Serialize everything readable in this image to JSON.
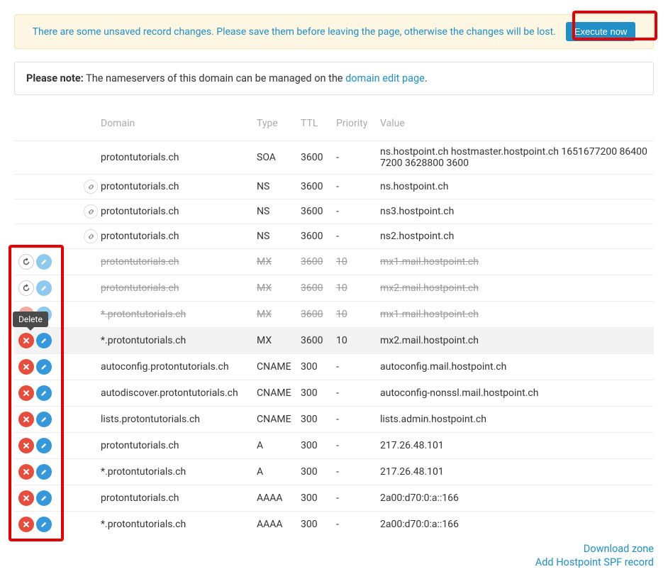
{
  "alert": {
    "message": "There are some unsaved record changes. Please save them before leaving the page, otherwise the changes will be lost.",
    "button": "Execute now"
  },
  "note": {
    "label": "Please note:",
    "text": " The nameservers of this domain can be managed on the ",
    "link": "domain edit page",
    "suffix": "."
  },
  "tooltip": {
    "delete": "Delete"
  },
  "headers": {
    "domain": "Domain",
    "type": "Type",
    "ttl": "TTL",
    "priority": "Priority",
    "value": "Value"
  },
  "rows": [
    {
      "actions": "none",
      "link": false,
      "domain": "protontutorials.ch",
      "type": "SOA",
      "ttl": "3600",
      "priority": "-",
      "value": "ns.hostpoint.ch hostmaster.hostpoint.ch 1651677200 86400 7200 3628800 3600",
      "struck": false,
      "highlight": false
    },
    {
      "actions": "link",
      "link": true,
      "domain": "protontutorials.ch",
      "type": "NS",
      "ttl": "3600",
      "priority": "-",
      "value": "ns.hostpoint.ch",
      "struck": false,
      "highlight": false
    },
    {
      "actions": "link",
      "link": true,
      "domain": "protontutorials.ch",
      "type": "NS",
      "ttl": "3600",
      "priority": "-",
      "value": "ns3.hostpoint.ch",
      "struck": false,
      "highlight": false
    },
    {
      "actions": "link",
      "link": true,
      "domain": "protontutorials.ch",
      "type": "NS",
      "ttl": "3600",
      "priority": "-",
      "value": "ns2.hostpoint.ch",
      "struck": false,
      "highlight": false
    },
    {
      "actions": "revert",
      "link": false,
      "domain": "protontutorials.ch",
      "type": "MX",
      "ttl": "3600",
      "priority": "10",
      "value": "mx1.mail.hostpoint.ch",
      "struck": true,
      "highlight": false
    },
    {
      "actions": "revert",
      "link": false,
      "domain": "protontutorials.ch",
      "type": "MX",
      "ttl": "3600",
      "priority": "10",
      "value": "mx2.mail.hostpoint.ch",
      "struck": true,
      "highlight": false
    },
    {
      "actions": "lightdel",
      "link": false,
      "domain": "*.protontutorials.ch",
      "type": "MX",
      "ttl": "3600",
      "priority": "10",
      "value": "mx1.mail.hostpoint.ch",
      "struck": true,
      "highlight": false
    },
    {
      "actions": "full",
      "link": false,
      "domain": "*.protontutorials.ch",
      "type": "MX",
      "ttl": "3600",
      "priority": "10",
      "value": "mx2.mail.hostpoint.ch",
      "struck": false,
      "highlight": true
    },
    {
      "actions": "full",
      "link": false,
      "domain": "autoconfig.protontutorials.ch",
      "type": "CNAME",
      "ttl": "300",
      "priority": "-",
      "value": "autoconfig.mail.hostpoint.ch",
      "struck": false,
      "highlight": false
    },
    {
      "actions": "full",
      "link": false,
      "domain": "autodiscover.protontutorials.ch",
      "type": "CNAME",
      "ttl": "300",
      "priority": "-",
      "value": "autoconfig-nonssl.mail.hostpoint.ch",
      "struck": false,
      "highlight": false
    },
    {
      "actions": "full",
      "link": false,
      "domain": "lists.protontutorials.ch",
      "type": "CNAME",
      "ttl": "300",
      "priority": "-",
      "value": "lists.admin.hostpoint.ch",
      "struck": false,
      "highlight": false
    },
    {
      "actions": "full",
      "link": false,
      "domain": "protontutorials.ch",
      "type": "A",
      "ttl": "300",
      "priority": "-",
      "value": "217.26.48.101",
      "struck": false,
      "highlight": false
    },
    {
      "actions": "full",
      "link": false,
      "domain": "*.protontutorials.ch",
      "type": "A",
      "ttl": "300",
      "priority": "-",
      "value": "217.26.48.101",
      "struck": false,
      "highlight": false
    },
    {
      "actions": "full",
      "link": false,
      "domain": "protontutorials.ch",
      "type": "AAAA",
      "ttl": "300",
      "priority": "-",
      "value": "2a00:d70:0:a::166",
      "struck": false,
      "highlight": false
    },
    {
      "actions": "full",
      "link": false,
      "domain": "*.protontutorials.ch",
      "type": "AAAA",
      "ttl": "300",
      "priority": "-",
      "value": "2a00:d70:0:a::166",
      "struck": false,
      "highlight": false
    }
  ],
  "footer": {
    "download": "Download zone",
    "spf": "Add Hostpoint SPF record"
  }
}
